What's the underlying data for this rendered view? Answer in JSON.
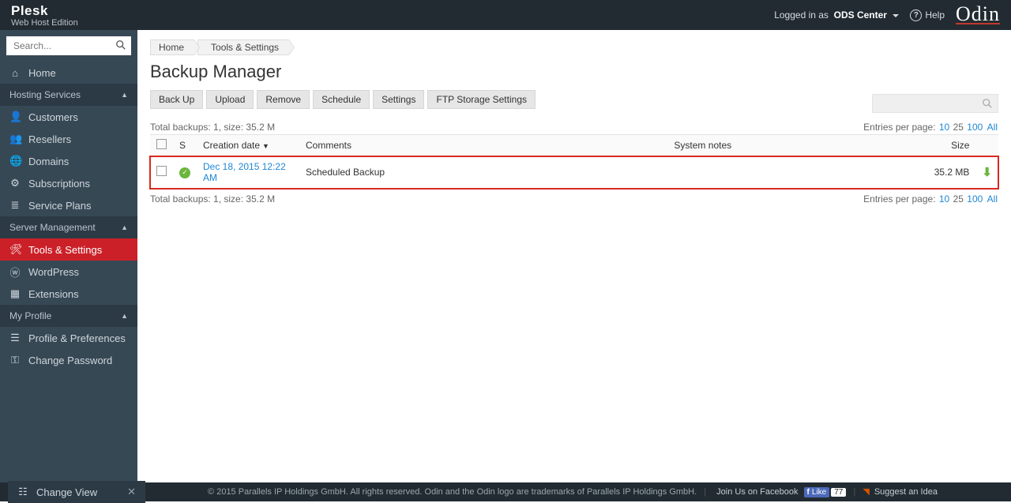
{
  "brand": {
    "name": "Plesk",
    "sub": "Web Host Edition"
  },
  "topbar": {
    "logged_in_prefix": "Logged in as",
    "user": "ODS Center",
    "help": "Help",
    "odin": "Odin"
  },
  "search": {
    "placeholder": "Search..."
  },
  "sidebar": {
    "home": "Home",
    "section1": "Hosting Services",
    "items1": [
      "Customers",
      "Resellers",
      "Domains",
      "Subscriptions",
      "Service Plans"
    ],
    "section2": "Server Management",
    "items2": [
      "Tools & Settings",
      "WordPress",
      "Extensions"
    ],
    "section3": "My Profile",
    "items3": [
      "Profile & Preferences",
      "Change Password"
    ]
  },
  "changeview": "Change View",
  "breadcrumbs": [
    "Home",
    "Tools & Settings"
  ],
  "page_title": "Backup Manager",
  "toolbar": {
    "backup": "Back Up",
    "upload": "Upload",
    "remove": "Remove",
    "schedule": "Schedule",
    "settings": "Settings",
    "ftp": "FTP Storage Settings"
  },
  "summary": "Total backups: 1, size: 35.2 M",
  "perpage": {
    "label": "Entries per page:",
    "opts": [
      "10",
      "25",
      "100",
      "All"
    ],
    "current": "25"
  },
  "table": {
    "headers": {
      "s": "S",
      "date": "Creation date",
      "comments": "Comments",
      "notes": "System notes",
      "size": "Size"
    },
    "rows": [
      {
        "date": "Dec 18, 2015 12:22 AM",
        "comments": "Scheduled Backup",
        "notes": "",
        "size": "35.2 MB"
      }
    ]
  },
  "footer": {
    "copy": "© 2015 Parallels IP Holdings GmbH. All rights reserved. Odin and the Odin logo are trademarks of Parallels IP Holdings GmbH.",
    "join": "Join Us on Facebook",
    "like": "Like",
    "like_count": "77",
    "suggest": "Suggest an Idea"
  }
}
